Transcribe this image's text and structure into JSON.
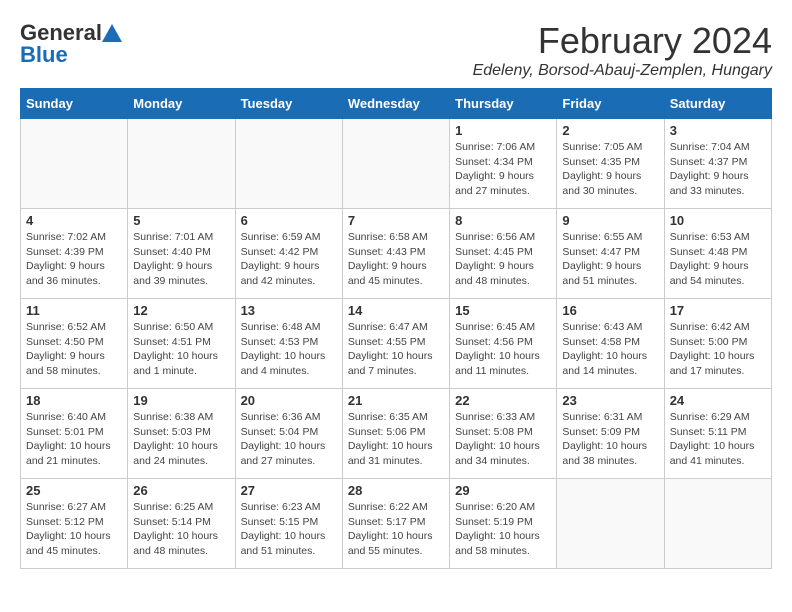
{
  "header": {
    "logo_general": "General",
    "logo_blue": "Blue",
    "month_title": "February 2024",
    "location": "Edeleny, Borsod-Abauj-Zemplen, Hungary"
  },
  "days_of_week": [
    "Sunday",
    "Monday",
    "Tuesday",
    "Wednesday",
    "Thursday",
    "Friday",
    "Saturday"
  ],
  "weeks": [
    [
      {
        "day": "",
        "sunrise": "",
        "sunset": "",
        "daylight": "",
        "empty": true
      },
      {
        "day": "",
        "sunrise": "",
        "sunset": "",
        "daylight": "",
        "empty": true
      },
      {
        "day": "",
        "sunrise": "",
        "sunset": "",
        "daylight": "",
        "empty": true
      },
      {
        "day": "",
        "sunrise": "",
        "sunset": "",
        "daylight": "",
        "empty": true
      },
      {
        "day": "1",
        "sunrise": "Sunrise: 7:06 AM",
        "sunset": "Sunset: 4:34 PM",
        "daylight": "Daylight: 9 hours and 27 minutes.",
        "empty": false
      },
      {
        "day": "2",
        "sunrise": "Sunrise: 7:05 AM",
        "sunset": "Sunset: 4:35 PM",
        "daylight": "Daylight: 9 hours and 30 minutes.",
        "empty": false
      },
      {
        "day": "3",
        "sunrise": "Sunrise: 7:04 AM",
        "sunset": "Sunset: 4:37 PM",
        "daylight": "Daylight: 9 hours and 33 minutes.",
        "empty": false
      }
    ],
    [
      {
        "day": "4",
        "sunrise": "Sunrise: 7:02 AM",
        "sunset": "Sunset: 4:39 PM",
        "daylight": "Daylight: 9 hours and 36 minutes.",
        "empty": false
      },
      {
        "day": "5",
        "sunrise": "Sunrise: 7:01 AM",
        "sunset": "Sunset: 4:40 PM",
        "daylight": "Daylight: 9 hours and 39 minutes.",
        "empty": false
      },
      {
        "day": "6",
        "sunrise": "Sunrise: 6:59 AM",
        "sunset": "Sunset: 4:42 PM",
        "daylight": "Daylight: 9 hours and 42 minutes.",
        "empty": false
      },
      {
        "day": "7",
        "sunrise": "Sunrise: 6:58 AM",
        "sunset": "Sunset: 4:43 PM",
        "daylight": "Daylight: 9 hours and 45 minutes.",
        "empty": false
      },
      {
        "day": "8",
        "sunrise": "Sunrise: 6:56 AM",
        "sunset": "Sunset: 4:45 PM",
        "daylight": "Daylight: 9 hours and 48 minutes.",
        "empty": false
      },
      {
        "day": "9",
        "sunrise": "Sunrise: 6:55 AM",
        "sunset": "Sunset: 4:47 PM",
        "daylight": "Daylight: 9 hours and 51 minutes.",
        "empty": false
      },
      {
        "day": "10",
        "sunrise": "Sunrise: 6:53 AM",
        "sunset": "Sunset: 4:48 PM",
        "daylight": "Daylight: 9 hours and 54 minutes.",
        "empty": false
      }
    ],
    [
      {
        "day": "11",
        "sunrise": "Sunrise: 6:52 AM",
        "sunset": "Sunset: 4:50 PM",
        "daylight": "Daylight: 9 hours and 58 minutes.",
        "empty": false
      },
      {
        "day": "12",
        "sunrise": "Sunrise: 6:50 AM",
        "sunset": "Sunset: 4:51 PM",
        "daylight": "Daylight: 10 hours and 1 minute.",
        "empty": false
      },
      {
        "day": "13",
        "sunrise": "Sunrise: 6:48 AM",
        "sunset": "Sunset: 4:53 PM",
        "daylight": "Daylight: 10 hours and 4 minutes.",
        "empty": false
      },
      {
        "day": "14",
        "sunrise": "Sunrise: 6:47 AM",
        "sunset": "Sunset: 4:55 PM",
        "daylight": "Daylight: 10 hours and 7 minutes.",
        "empty": false
      },
      {
        "day": "15",
        "sunrise": "Sunrise: 6:45 AM",
        "sunset": "Sunset: 4:56 PM",
        "daylight": "Daylight: 10 hours and 11 minutes.",
        "empty": false
      },
      {
        "day": "16",
        "sunrise": "Sunrise: 6:43 AM",
        "sunset": "Sunset: 4:58 PM",
        "daylight": "Daylight: 10 hours and 14 minutes.",
        "empty": false
      },
      {
        "day": "17",
        "sunrise": "Sunrise: 6:42 AM",
        "sunset": "Sunset: 5:00 PM",
        "daylight": "Daylight: 10 hours and 17 minutes.",
        "empty": false
      }
    ],
    [
      {
        "day": "18",
        "sunrise": "Sunrise: 6:40 AM",
        "sunset": "Sunset: 5:01 PM",
        "daylight": "Daylight: 10 hours and 21 minutes.",
        "empty": false
      },
      {
        "day": "19",
        "sunrise": "Sunrise: 6:38 AM",
        "sunset": "Sunset: 5:03 PM",
        "daylight": "Daylight: 10 hours and 24 minutes.",
        "empty": false
      },
      {
        "day": "20",
        "sunrise": "Sunrise: 6:36 AM",
        "sunset": "Sunset: 5:04 PM",
        "daylight": "Daylight: 10 hours and 27 minutes.",
        "empty": false
      },
      {
        "day": "21",
        "sunrise": "Sunrise: 6:35 AM",
        "sunset": "Sunset: 5:06 PM",
        "daylight": "Daylight: 10 hours and 31 minutes.",
        "empty": false
      },
      {
        "day": "22",
        "sunrise": "Sunrise: 6:33 AM",
        "sunset": "Sunset: 5:08 PM",
        "daylight": "Daylight: 10 hours and 34 minutes.",
        "empty": false
      },
      {
        "day": "23",
        "sunrise": "Sunrise: 6:31 AM",
        "sunset": "Sunset: 5:09 PM",
        "daylight": "Daylight: 10 hours and 38 minutes.",
        "empty": false
      },
      {
        "day": "24",
        "sunrise": "Sunrise: 6:29 AM",
        "sunset": "Sunset: 5:11 PM",
        "daylight": "Daylight: 10 hours and 41 minutes.",
        "empty": false
      }
    ],
    [
      {
        "day": "25",
        "sunrise": "Sunrise: 6:27 AM",
        "sunset": "Sunset: 5:12 PM",
        "daylight": "Daylight: 10 hours and 45 minutes.",
        "empty": false
      },
      {
        "day": "26",
        "sunrise": "Sunrise: 6:25 AM",
        "sunset": "Sunset: 5:14 PM",
        "daylight": "Daylight: 10 hours and 48 minutes.",
        "empty": false
      },
      {
        "day": "27",
        "sunrise": "Sunrise: 6:23 AM",
        "sunset": "Sunset: 5:15 PM",
        "daylight": "Daylight: 10 hours and 51 minutes.",
        "empty": false
      },
      {
        "day": "28",
        "sunrise": "Sunrise: 6:22 AM",
        "sunset": "Sunset: 5:17 PM",
        "daylight": "Daylight: 10 hours and 55 minutes.",
        "empty": false
      },
      {
        "day": "29",
        "sunrise": "Sunrise: 6:20 AM",
        "sunset": "Sunset: 5:19 PM",
        "daylight": "Daylight: 10 hours and 58 minutes.",
        "empty": false
      },
      {
        "day": "",
        "sunrise": "",
        "sunset": "",
        "daylight": "",
        "empty": true
      },
      {
        "day": "",
        "sunrise": "",
        "sunset": "",
        "daylight": "",
        "empty": true
      }
    ]
  ]
}
